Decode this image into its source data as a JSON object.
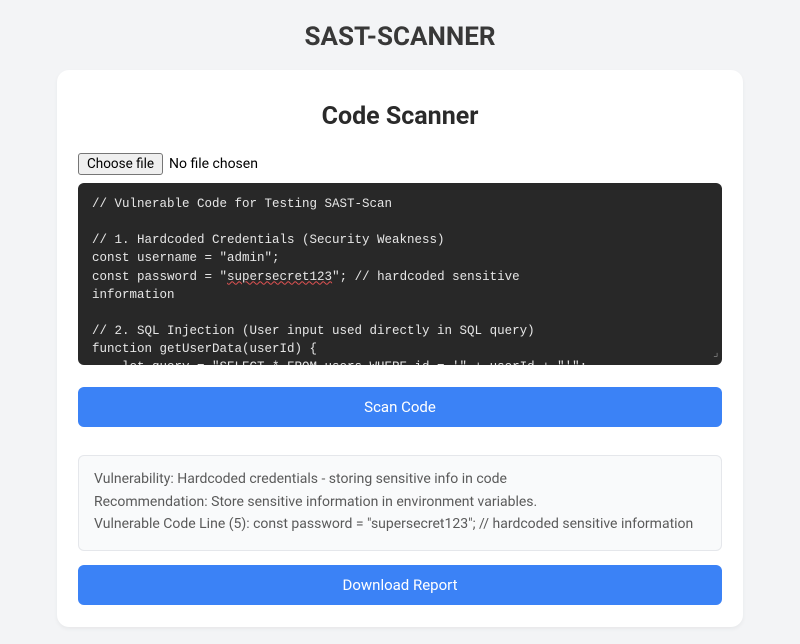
{
  "header": {
    "app_title": "SAST-SCANNER"
  },
  "card": {
    "title": "Code Scanner",
    "file_input": {
      "button_label": "Choose file",
      "status": "No file chosen"
    },
    "code_lines": [
      "// Vulnerable Code for Testing SAST-Scan",
      "",
      "// 1. Hardcoded Credentials (Security Weakness)",
      "const username = \"admin\";",
      {
        "prefix": "const password = \"",
        "underlined": "supersecret123",
        "suffix": "\"; // hardcoded sensitive"
      },
      "information",
      "",
      "// 2. SQL Injection (User input used directly in SQL query)",
      "function getUserData(userId) {",
      "    let query = \"SELECT * FROM users WHERE id = '\" + userId + \"'\";"
    ],
    "scan_button": "Scan Code",
    "result": {
      "line1": "Vulnerability: Hardcoded credentials - storing sensitive info in code",
      "line2": "Recommendation: Store sensitive information in environment variables.",
      "line3": "Vulnerable Code Line (5): const password = \"supersecret123\"; // hardcoded sensitive information"
    },
    "download_button": "Download Report"
  }
}
